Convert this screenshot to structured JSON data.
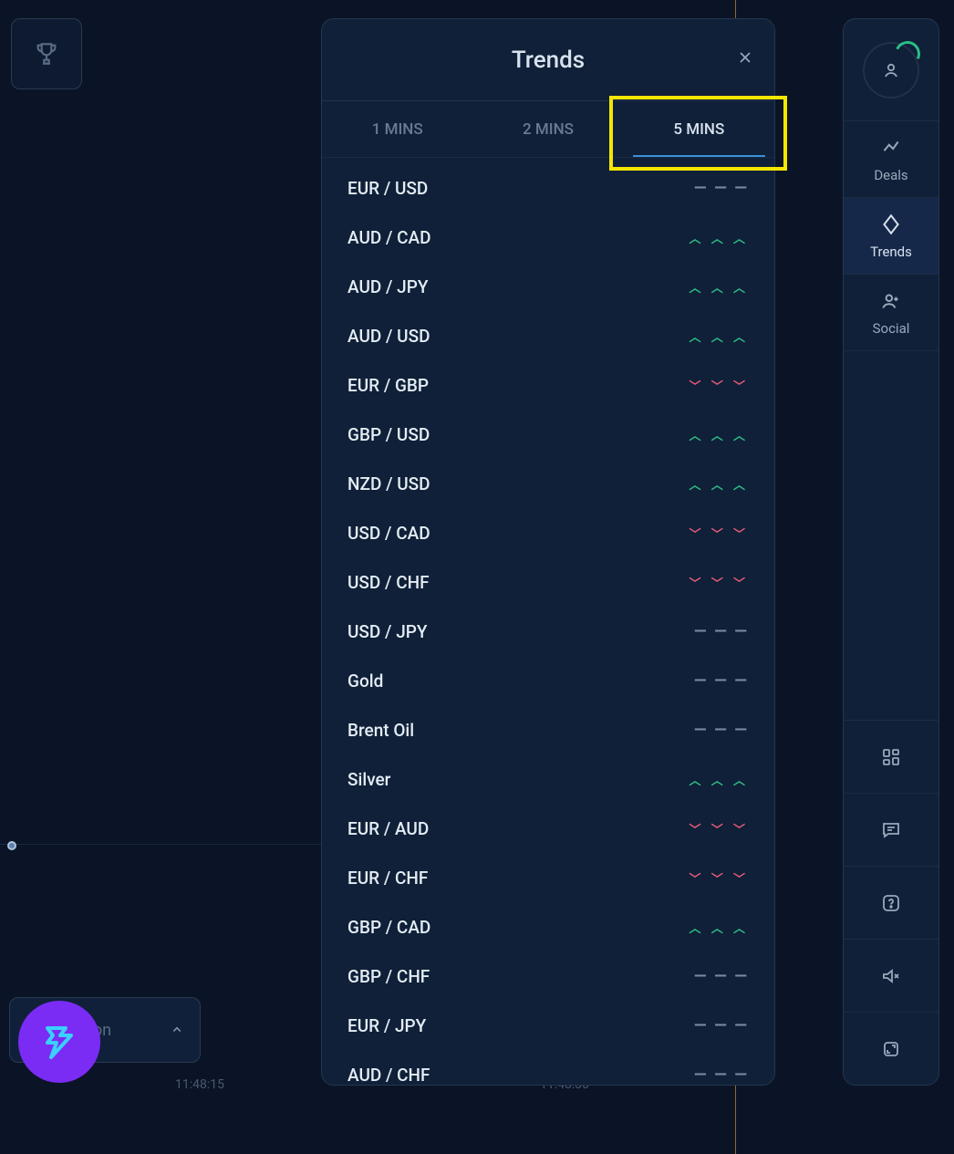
{
  "panel": {
    "title": "Trends",
    "tabs": [
      "1 MINS",
      "2 MINS",
      "5 MINS"
    ],
    "active_tab_index": 2,
    "rows": [
      {
        "pair": "EUR / USD",
        "trend": "neutral"
      },
      {
        "pair": "AUD / CAD",
        "trend": "up"
      },
      {
        "pair": "AUD / JPY",
        "trend": "up"
      },
      {
        "pair": "AUD / USD",
        "trend": "up"
      },
      {
        "pair": "EUR / GBP",
        "trend": "down"
      },
      {
        "pair": "GBP / USD",
        "trend": "up"
      },
      {
        "pair": "NZD / USD",
        "trend": "up"
      },
      {
        "pair": "USD / CAD",
        "trend": "down"
      },
      {
        "pair": "USD / CHF",
        "trend": "down"
      },
      {
        "pair": "USD / JPY",
        "trend": "neutral"
      },
      {
        "pair": "Gold",
        "trend": "neutral"
      },
      {
        "pair": "Brent Oil",
        "trend": "neutral"
      },
      {
        "pair": "Silver",
        "trend": "up"
      },
      {
        "pair": "EUR / AUD",
        "trend": "down"
      },
      {
        "pair": "EUR / CHF",
        "trend": "down"
      },
      {
        "pair": "GBP / CAD",
        "trend": "up"
      },
      {
        "pair": "GBP / CHF",
        "trend": "neutral"
      },
      {
        "pair": "EUR / JPY",
        "trend": "neutral"
      },
      {
        "pair": "AUD / CHF",
        "trend": "neutral"
      }
    ]
  },
  "rail": {
    "items": [
      {
        "id": "deals",
        "label": "Deals"
      },
      {
        "id": "trends",
        "label": "Trends"
      },
      {
        "id": "social",
        "label": "Social"
      }
    ],
    "active_index": 1
  },
  "chart": {
    "time_labels": [
      "11:48:15",
      "11:48:30"
    ]
  },
  "bottom_chip": {
    "text": "ation"
  }
}
